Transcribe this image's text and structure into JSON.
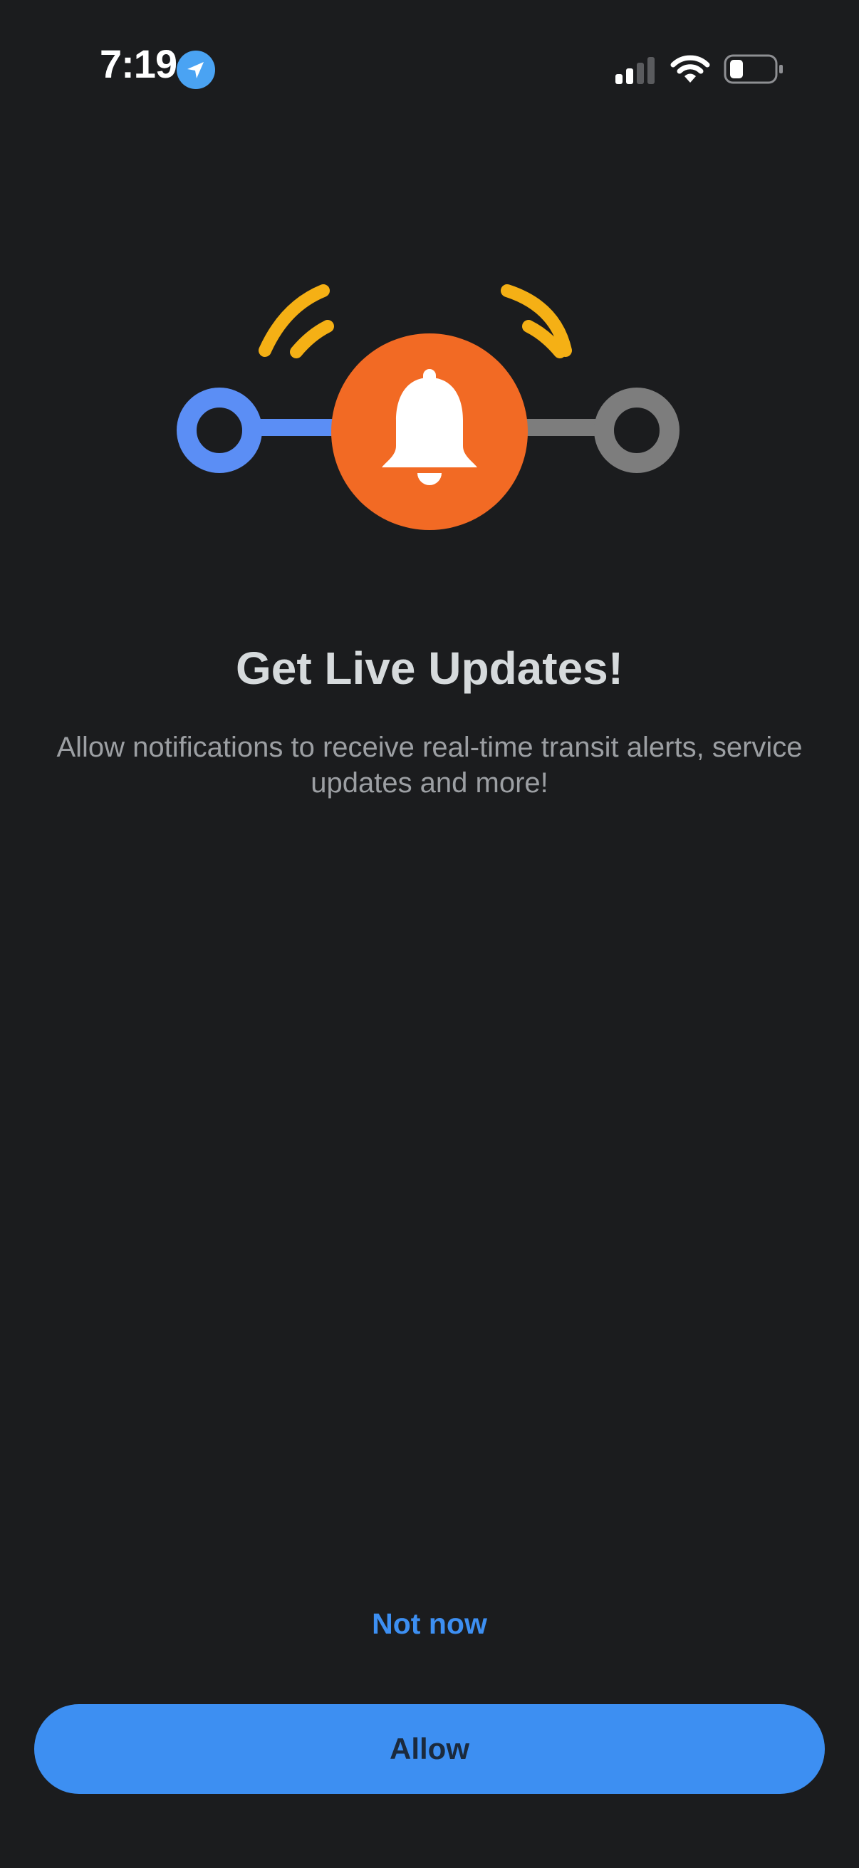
{
  "status_bar": {
    "time": "7:19",
    "location_icon": "location-arrow-icon",
    "signal_icon": "cellular-signal-icon",
    "wifi_icon": "wifi-icon",
    "battery_icon": "battery-icon"
  },
  "illustration": {
    "icon": "bell-icon",
    "colors": {
      "bell_circle": "#f26a24",
      "left_node": "#5b8ef5",
      "right_node": "#7d7d7d",
      "waves": "#f5b015"
    }
  },
  "content": {
    "title": "Get Live Updates!",
    "subtitle": "Allow notifications to receive real-time transit alerts, service updates and more!"
  },
  "actions": {
    "not_now_label": "Not now",
    "allow_label": "Allow"
  },
  "colors": {
    "background": "#1b1c1e",
    "accent": "#3d8ff2"
  }
}
